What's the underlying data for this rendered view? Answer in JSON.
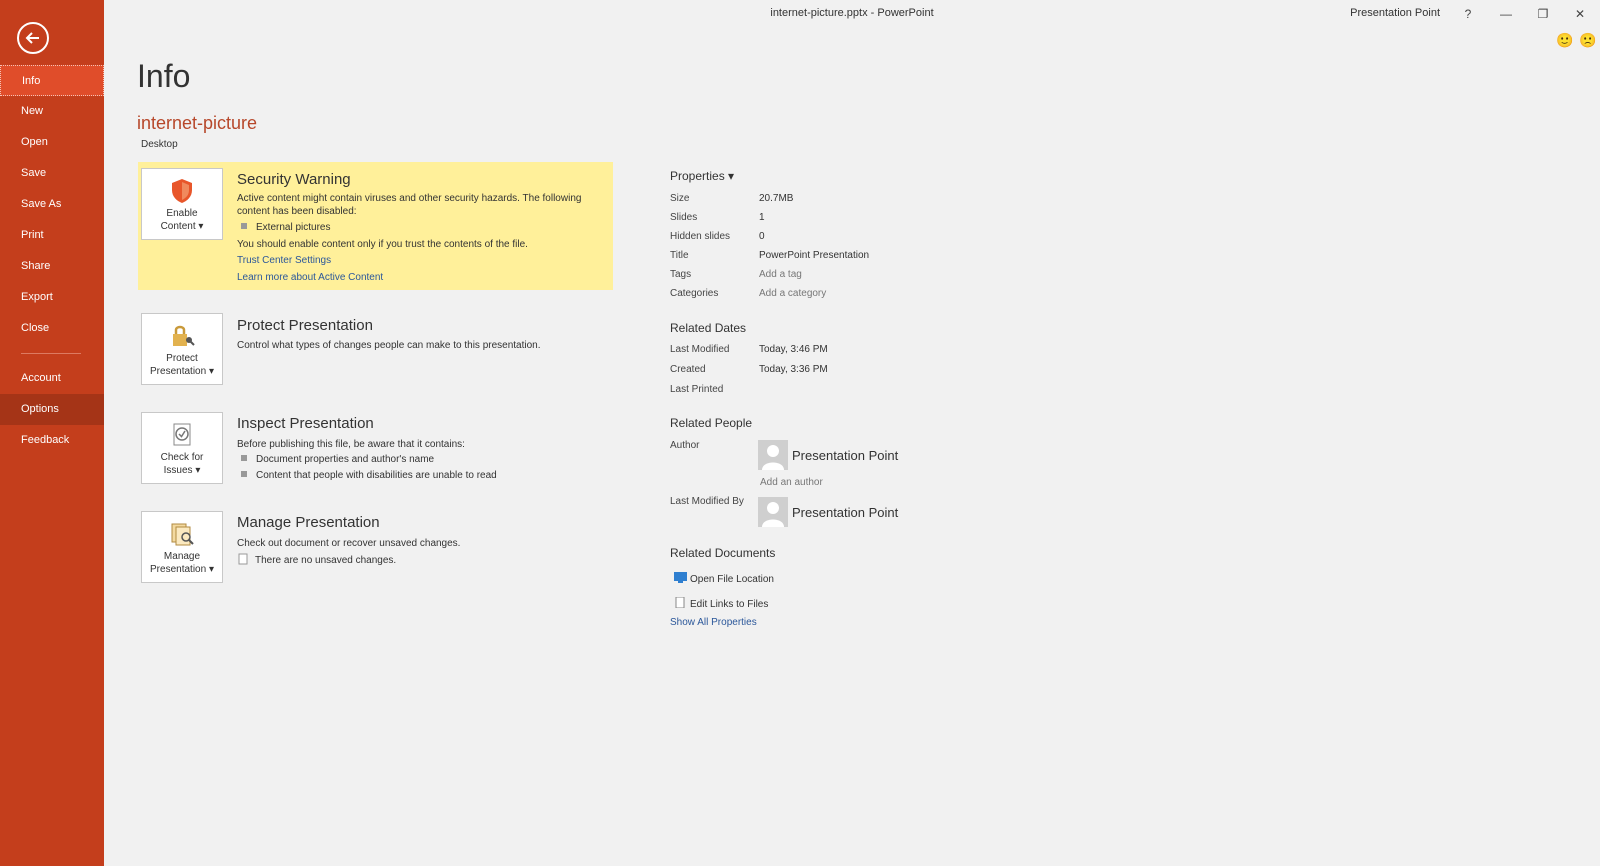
{
  "window": {
    "title": "internet-picture.pptx - PowerPoint",
    "user": "Presentation Point",
    "help": "?",
    "minimize": "—",
    "restore": "❐",
    "close": "✕"
  },
  "feedback": {
    "smile": "🙂",
    "frown": "🙁"
  },
  "sidebar": {
    "items": [
      {
        "label": "Info"
      },
      {
        "label": "New"
      },
      {
        "label": "Open"
      },
      {
        "label": "Save"
      },
      {
        "label": "Save As"
      },
      {
        "label": "Print"
      },
      {
        "label": "Share"
      },
      {
        "label": "Export"
      },
      {
        "label": "Close"
      },
      {
        "label": "Account"
      },
      {
        "label": "Options"
      },
      {
        "label": "Feedback"
      }
    ],
    "active": "Info",
    "colors": {
      "background": "#c43e1c",
      "active": "#e04d2a"
    }
  },
  "page": {
    "title": "Info",
    "file_name": "internet-picture",
    "location": "Desktop"
  },
  "security": {
    "tile_label_1": "Enable",
    "tile_label_2": "Content ▾",
    "title": "Security Warning",
    "desc": "Active content might contain viruses and other security hazards. The following content has been disabled:",
    "bullet": "External pictures",
    "note": "You should enable content only if you trust the contents of the file.",
    "link_trust": "Trust Center Settings",
    "link_learn": "Learn more about Active Content",
    "color": "#fff09a"
  },
  "protect": {
    "tile_label_1": "Protect",
    "tile_label_2": "Presentation ▾",
    "title": "Protect Presentation",
    "desc": "Control what types of changes people can make to this presentation."
  },
  "inspect": {
    "tile_label_1": "Check for",
    "tile_label_2": "Issues ▾",
    "title": "Inspect Presentation",
    "desc": "Before publishing this file, be aware that it contains:",
    "bullets": [
      "Document properties and author's name",
      "Content that people with disabilities are unable to read"
    ]
  },
  "manage": {
    "tile_label_1": "Manage",
    "tile_label_2": "Presentation ▾",
    "title": "Manage Presentation",
    "desc": "Check out document or recover unsaved changes.",
    "note": "There are no unsaved changes."
  },
  "properties": {
    "header": "Properties ▾",
    "rows": [
      {
        "label": "Size",
        "value": "20.7MB"
      },
      {
        "label": "Slides",
        "value": "1"
      },
      {
        "label": "Hidden slides",
        "value": "0"
      },
      {
        "label": "Title",
        "value": "PowerPoint Presentation"
      },
      {
        "label": "Tags",
        "value": "Add a tag"
      },
      {
        "label": "Categories",
        "value": "Add a category"
      }
    ]
  },
  "related_dates": {
    "header": "Related Dates",
    "rows": [
      {
        "label": "Last Modified",
        "value": "Today, 3:46 PM"
      },
      {
        "label": "Created",
        "value": "Today, 3:36 PM"
      },
      {
        "label": "Last Printed",
        "value": ""
      }
    ]
  },
  "related_people": {
    "header": "Related People",
    "author_label": "Author",
    "author": "Presentation Point",
    "add_author": "Add an author",
    "modified_by_label": "Last Modified By",
    "modified_by": "Presentation Point"
  },
  "related_documents": {
    "header": "Related Documents",
    "open_location": "Open File Location",
    "edit_links": "Edit Links to Files",
    "show_all": "Show All Properties"
  }
}
